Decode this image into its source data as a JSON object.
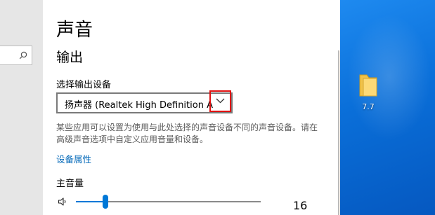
{
  "page": {
    "title": "声音",
    "section_title": "输出"
  },
  "output_device": {
    "label": "选择输出设备",
    "selected_value": "扬声器 (Realtek High Definition Audi..."
  },
  "description": "某些应用可以设置为使用与此处选择的声音设备不同的声音设备。请在高级声音选项中自定义应用音量和设备。",
  "device_properties_link": "设备属性",
  "volume": {
    "label": "主音量",
    "value_text": "16",
    "level": 0.16
  },
  "desktop": {
    "icon_label": "7.7"
  },
  "colors": {
    "accent": "#0078d7",
    "link": "#0067b8",
    "highlight_box": "#e01010",
    "desktop_background": "#0a6fd9"
  },
  "icons": [
    "search-icon",
    "chevron-down-icon",
    "speaker-icon",
    "folder-icon"
  ]
}
